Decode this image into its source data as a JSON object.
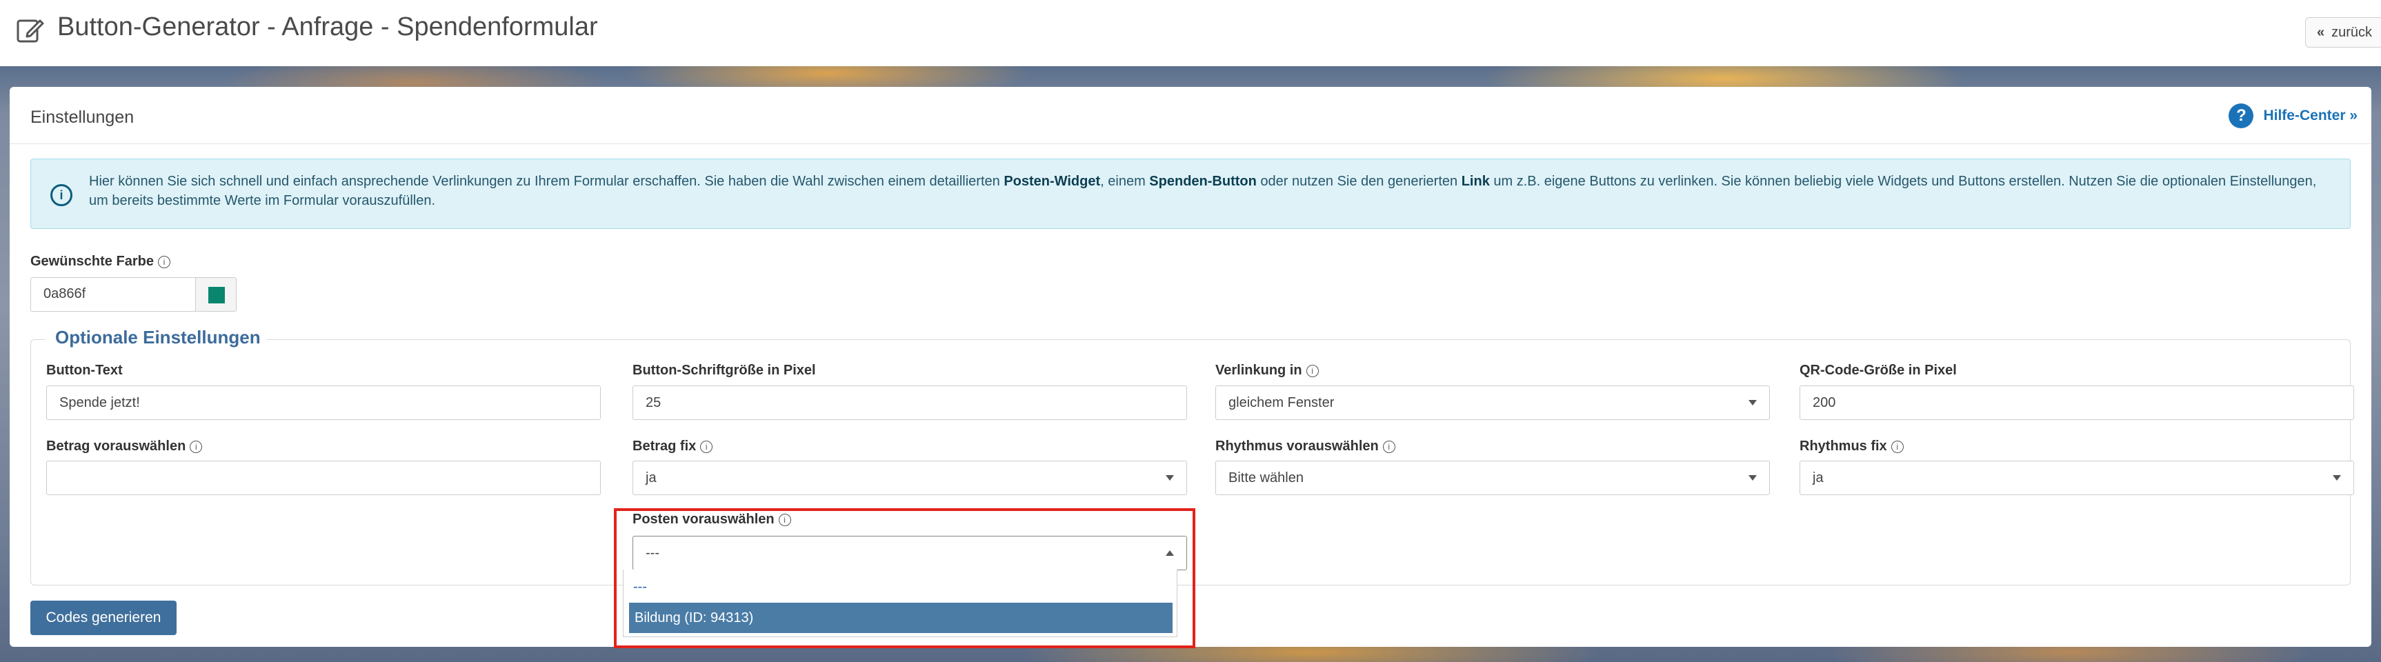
{
  "header": {
    "title": "Button-Generator - Anfrage - Spendenformular",
    "back_label": "zurück"
  },
  "panel": {
    "title": "Einstellungen",
    "help_label": "Hilfe-Center »",
    "info": {
      "t1": "Hier können Sie sich schnell und einfach ansprechende Verlinkungen zu Ihrem Formular erschaffen. Sie haben die Wahl zwischen einem detaillierten ",
      "b1": "Posten-Widget",
      "t2": ", einem ",
      "b2": "Spenden-Button",
      "t3": " oder nutzen Sie den generierten ",
      "b3": "Link",
      "t4": " um z.B. eigene Buttons zu verlinken. Sie können beliebig viele Widgets und Buttons erstellen. Nutzen Sie die optionalen Einstellungen, um bereits bestimmte Werte im Formular vorauszufüllen."
    }
  },
  "color": {
    "label": "Gewünschte Farbe",
    "value": "0a866f",
    "swatch": "#0a866f"
  },
  "optional": {
    "legend": "Optionale Einstellungen",
    "button_text": {
      "label": "Button-Text",
      "value": "Spende jetzt!"
    },
    "font_size": {
      "label": "Button-Schriftgröße in Pixel",
      "value": "25"
    },
    "link_in": {
      "label": "Verlinkung in",
      "value": "gleichem Fenster"
    },
    "qr_size": {
      "label": "QR-Code-Größe in Pixel",
      "value": "200"
    },
    "amount_preselect": {
      "label": "Betrag vorauswählen",
      "value": ""
    },
    "amount_fixed": {
      "label": "Betrag fix",
      "value": "ja"
    },
    "rhythm_preselect": {
      "label": "Rhythmus vorauswählen",
      "value": "Bitte wählen"
    },
    "rhythm_fixed": {
      "label": "Rhythmus fix",
      "value": "ja"
    },
    "post_preselect": {
      "label": "Posten vorauswählen",
      "value": "---",
      "options": [
        "---",
        "Bildung (ID: 94313)"
      ]
    }
  },
  "generate_label": "Codes generieren",
  "colors": {
    "accent": "#3f6f9c",
    "highlight": "#e2231a",
    "info_bg": "#def2f8"
  }
}
